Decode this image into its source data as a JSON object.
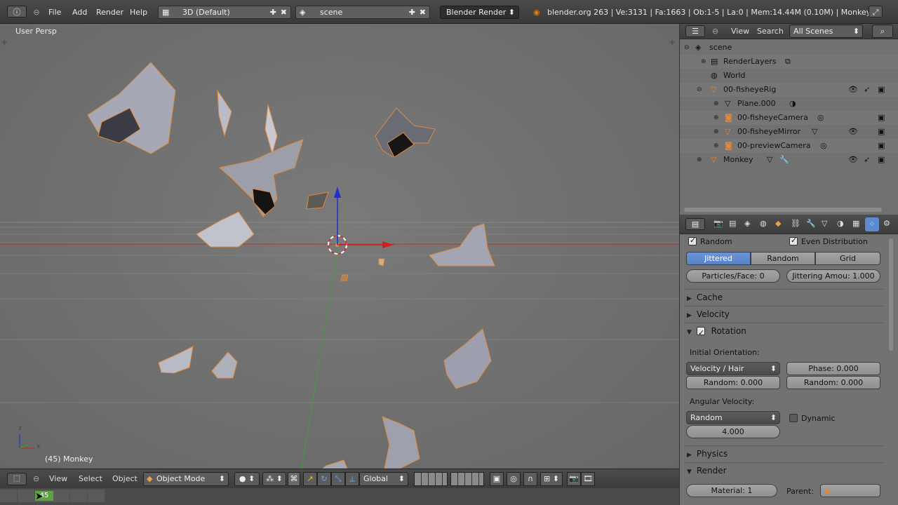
{
  "topbar": {
    "menus": [
      "File",
      "Add",
      "Render",
      "Help"
    ],
    "screen_layout": "3D (Default)",
    "scene_name": "scene",
    "render_engine": "Blender Render",
    "status": "blender.org 263 | Ve:3131 | Fa:1663 | Ob:1-5 | La:0 | Mem:14.44M (0.10M) | Monkey"
  },
  "viewport": {
    "view_label": "User Persp",
    "object_label": "(45) Monkey",
    "axis_z": "z",
    "axis_x": "x"
  },
  "header3d": {
    "menus": [
      "View",
      "Select",
      "Object"
    ],
    "mode": "Object Mode",
    "orientation": "Global"
  },
  "timeline": {
    "frame": "45"
  },
  "outliner": {
    "menus": [
      "View",
      "Search"
    ],
    "scene_filter": "All Scenes",
    "items": [
      {
        "label": "scene"
      },
      {
        "label": "RenderLayers"
      },
      {
        "label": "World"
      },
      {
        "label": "00-fisheyeRig"
      },
      {
        "label": "Plane.000"
      },
      {
        "label": "00-fisheyeCamera"
      },
      {
        "label": "00-fisheyeMirror"
      },
      {
        "label": "00-previewCamera"
      },
      {
        "label": "Monkey"
      }
    ]
  },
  "properties": {
    "random_label": "Random",
    "even_distribution_label": "Even Distribution",
    "distribution_tabs": [
      "Jittered",
      "Random",
      "Grid"
    ],
    "particles_face": "Particles/Face: 0",
    "jittering_amount": "Jittering Amou: 1.000",
    "panels": {
      "cache": "Cache",
      "velocity": "Velocity",
      "rotation": "Rotation",
      "physics": "Physics",
      "render": "Render"
    },
    "initial_orientation_label": "Initial Orientation:",
    "orientation_value": "Velocity / Hair",
    "phase": "Phase: 0.000",
    "random1": "Random: 0.000",
    "random2": "Random: 0.000",
    "angular_velocity_label": "Angular Velocity:",
    "angular_mode": "Random",
    "dynamic_label": "Dynamic",
    "angular_value": "4.000",
    "material": "Material: 1",
    "parent_label": "Parent:"
  },
  "colors": {
    "selection_outline": "#e08a3a",
    "x_axis": "#d02020",
    "y_axis": "#20b020",
    "z_axis": "#2030d0",
    "active_tab": "#5d8ad0"
  }
}
